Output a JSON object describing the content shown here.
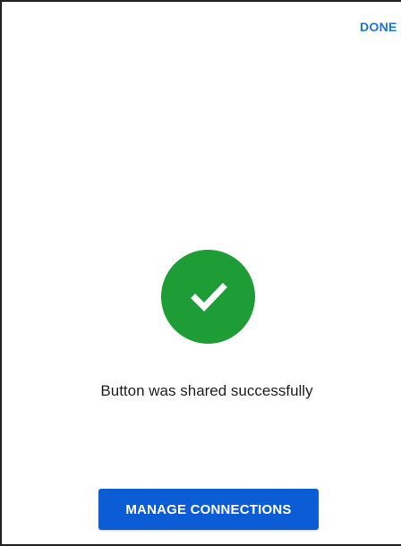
{
  "header": {
    "done_label": "DONE"
  },
  "status": {
    "icon": "check-circle-icon",
    "icon_color": "#1e9c35",
    "message": "Button was shared successfully"
  },
  "actions": {
    "manage_label": "MANAGE CONNECTIONS",
    "accent_color": "#0b5cd5"
  }
}
